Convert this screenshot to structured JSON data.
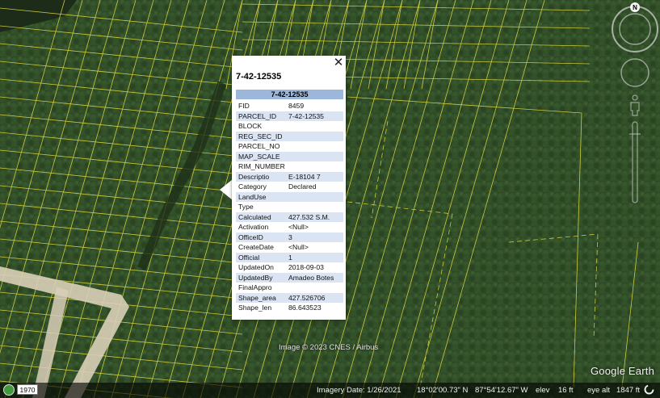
{
  "parcel": {
    "title": "7-42-12535",
    "header": "7-42-12535",
    "attributes": [
      {
        "key": "FID",
        "value": "8459"
      },
      {
        "key": "PARCEL_ID",
        "value": "7-42-12535"
      },
      {
        "key": "BLOCK",
        "value": ""
      },
      {
        "key": "REG_SEC_ID",
        "value": ""
      },
      {
        "key": "PARCEL_NO",
        "value": ""
      },
      {
        "key": "MAP_SCALE",
        "value": ""
      },
      {
        "key": "RIM_NUMBER",
        "value": ""
      },
      {
        "key": "Descriptio",
        "value": "E-18104 7"
      },
      {
        "key": "Category",
        "value": "Declared"
      },
      {
        "key": "LandUse",
        "value": ""
      },
      {
        "key": "Type",
        "value": ""
      },
      {
        "key": "Calculated",
        "value": "427.532 S.M."
      },
      {
        "key": "Activation",
        "value": "<Null>"
      },
      {
        "key": "OfficeID",
        "value": "3"
      },
      {
        "key": "CreateDate",
        "value": "<Null>"
      },
      {
        "key": "Official",
        "value": "1"
      },
      {
        "key": "UpdatedOn",
        "value": "2018-09-03"
      },
      {
        "key": "UpdatedBy",
        "value": "Amadeo Botes"
      },
      {
        "key": "FinalAppro",
        "value": ""
      },
      {
        "key": "Shape_area",
        "value": "427.526706"
      },
      {
        "key": "Shape_len",
        "value": "86.643523"
      }
    ]
  },
  "map": {
    "credit": "Image © 2023 CNES / Airbus",
    "logo": "Google Earth",
    "compass_label": "N",
    "close_glyph": "✕",
    "colors": {
      "parcel_line": "#e8e040",
      "vegetation": "#2e4a26",
      "road": "#d9cfb8"
    }
  },
  "status": {
    "year": "1970",
    "imagery_date": "Imagery Date: 1/26/2021",
    "latitude": "18°02'00.73\" N",
    "longitude": "87°54'12.67\" W",
    "elevation_label": "elev",
    "elevation_value": "16 ft",
    "eye_alt_label": "eye alt",
    "eye_alt_value": "1847 ft"
  }
}
